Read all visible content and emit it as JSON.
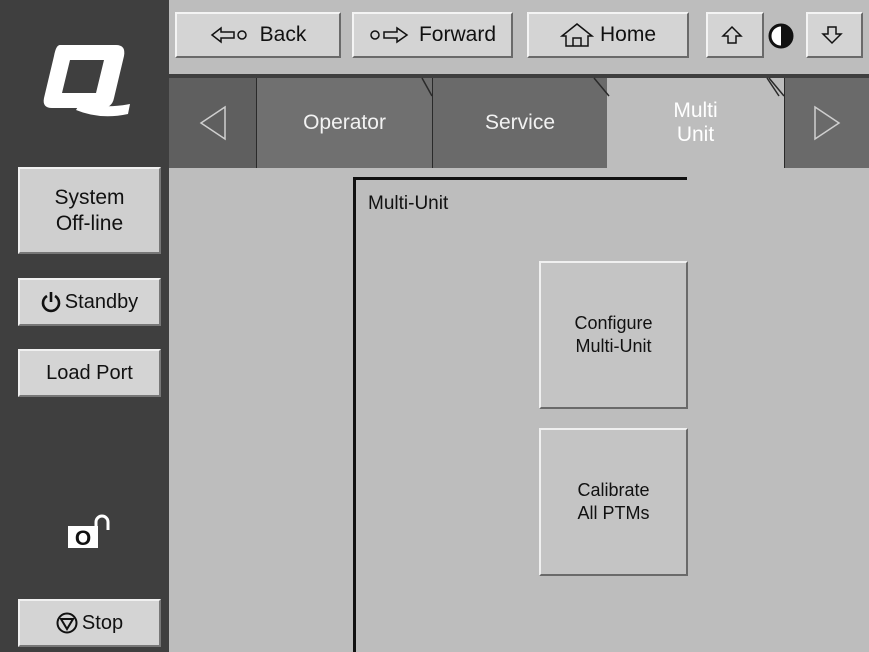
{
  "app": {
    "logo_alt": "Q",
    "status": [
      "System",
      "Off-line"
    ]
  },
  "toolbar": {
    "back_label": "Back",
    "forward_label": "Forward",
    "home_label": "Home"
  },
  "tabs": [
    {
      "label": "Operator",
      "active": false
    },
    {
      "label": "Service",
      "active": false
    },
    {
      "label": "Multi Unit",
      "line1": "Multi",
      "line2": "Unit",
      "active": true
    }
  ],
  "sidebar": {
    "standby_label": "Standby",
    "load_port_label": "Load Port",
    "lock_state": "unlocked",
    "stop_label": "Stop"
  },
  "panel": {
    "title": "Multi-Unit",
    "buttons": [
      {
        "line1": "Configure",
        "line2": "Multi-Unit"
      },
      {
        "line1": "Calibrate",
        "line2": "All PTMs"
      }
    ]
  },
  "colors": {
    "sidebar_bg": "#3f3f3f",
    "button_face": "#d4d4d4",
    "panel_bg": "#bdbdbd",
    "inactive_tab": "#707070"
  }
}
